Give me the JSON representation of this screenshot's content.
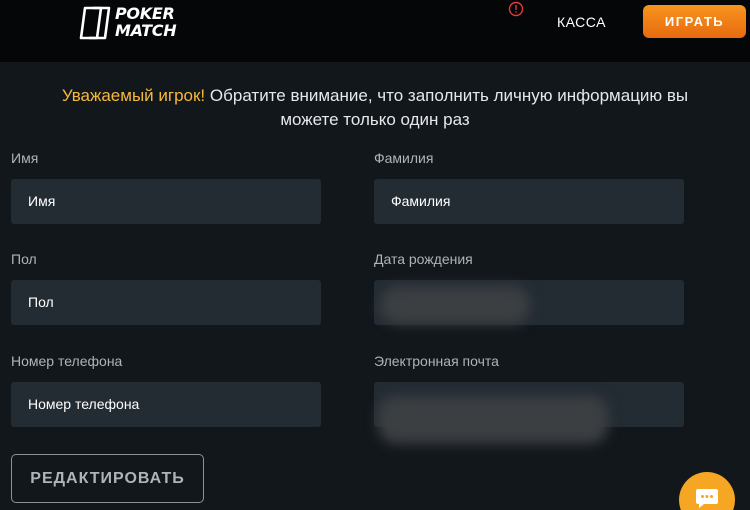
{
  "header": {
    "logo_line1": "POKER",
    "logo_line2": "MATCH",
    "kassa_label": "КАССА",
    "play_label": "ИГРАТЬ"
  },
  "notice": {
    "highlight": "Уважаемый игрок!",
    "text": "Обратите внимание, что заполнить личную информацию вы можете только один раз"
  },
  "form": {
    "first_name": {
      "label": "Имя",
      "value": "Имя"
    },
    "last_name": {
      "label": "Фамилия",
      "value": "Фамилия"
    },
    "gender": {
      "label": "Пол",
      "value": "Пол"
    },
    "birth_date": {
      "label": "Дата рождения",
      "value": ""
    },
    "phone": {
      "label": "Номер телефона",
      "value": "Номер телефона"
    },
    "email": {
      "label": "Электронная почта",
      "value": ""
    },
    "edit_label": "РЕДАКТИРОВАТЬ"
  },
  "colors": {
    "accent": "#f7941d",
    "highlight_text": "#f5b83c",
    "background": "#12171c",
    "field_bg": "#232b33"
  },
  "icons": [
    "poker-match-logo-icon",
    "alert-icon",
    "chat-icon"
  ]
}
